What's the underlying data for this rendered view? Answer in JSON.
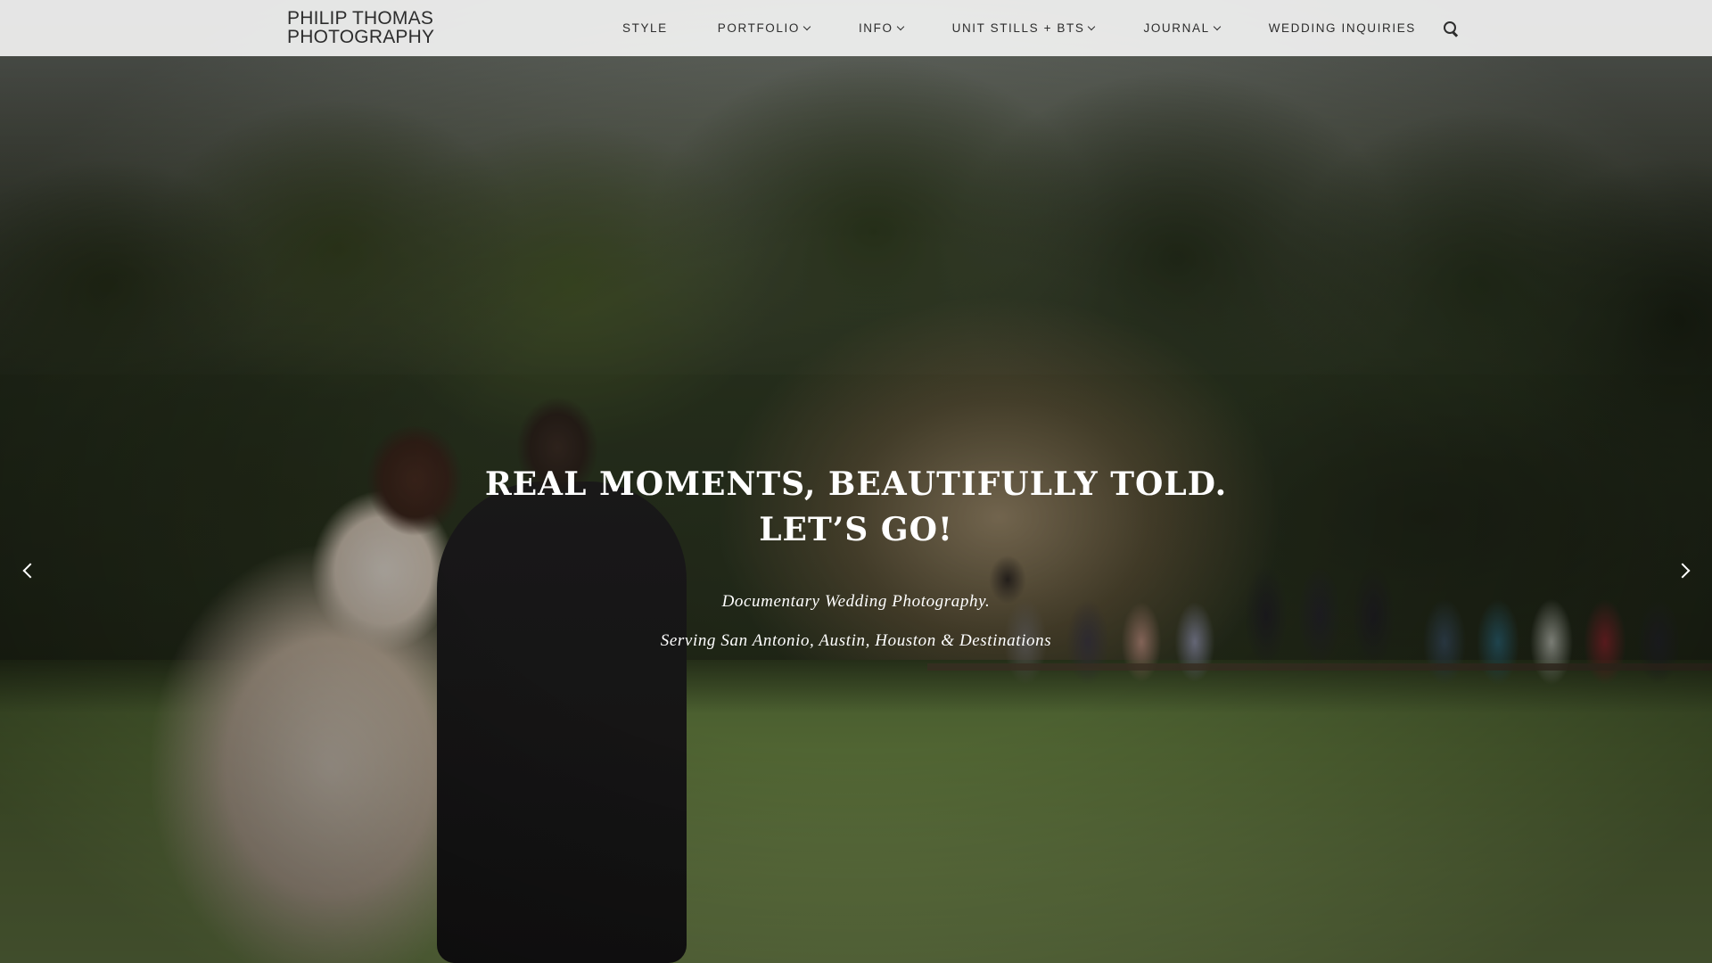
{
  "brand": {
    "line1": "PHILIP THOMAS",
    "line2": "PHOTOGRAPHY"
  },
  "nav": {
    "items": [
      {
        "label": "STYLE",
        "has_dropdown": false
      },
      {
        "label": "PORTFOLIO",
        "has_dropdown": true
      },
      {
        "label": "INFO",
        "has_dropdown": true
      },
      {
        "label": "UNIT STILLS + BTS",
        "has_dropdown": true
      },
      {
        "label": "JOURNAL",
        "has_dropdown": true
      },
      {
        "label": "WEDDING INQUIRIES",
        "has_dropdown": false
      }
    ],
    "search_icon": "search-icon",
    "dropdown_icon": "chevron-down-icon"
  },
  "hero": {
    "headline_line1": "REAL MOMENTS, BEAUTIFULLY TOLD.",
    "headline_line2": "LET’S GO!",
    "subline1": "Documentary Wedding Photography.",
    "subline2": "Serving San Antonio, Austin, Houston & Destinations",
    "prev_icon": "chevron-left-icon",
    "next_icon": "chevron-right-icon"
  },
  "colors": {
    "header_bg": "#ffffff",
    "nav_text": "#2d2d2d",
    "hero_text": "#ffffff"
  }
}
